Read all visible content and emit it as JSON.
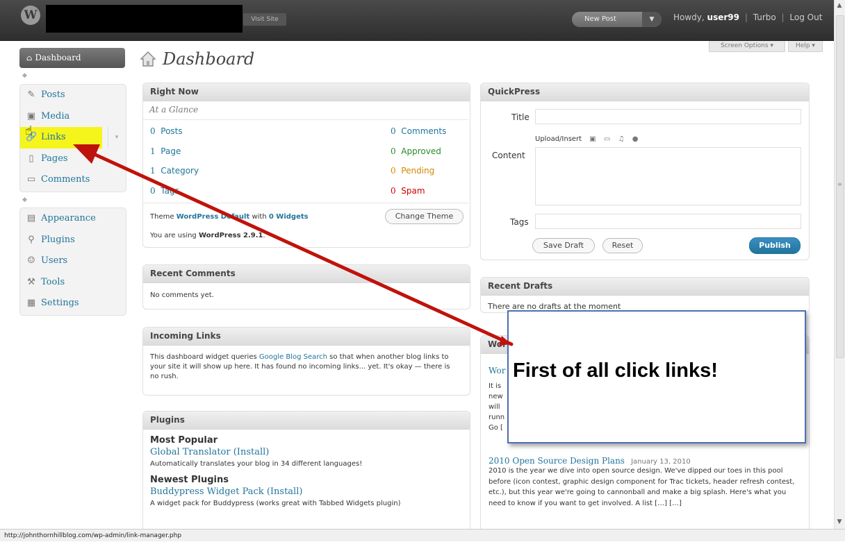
{
  "topbar": {
    "visit_site": "Visit Site",
    "new_post": "New Post",
    "howdy_prefix": "Howdy,",
    "user": "user99",
    "turbo": "Turbo",
    "logout": "Log Out",
    "screen_options": "Screen Options",
    "help": "Help"
  },
  "sidebar": {
    "dashboard": "Dashboard",
    "group1": [
      {
        "label": "Posts",
        "icon": "pin-icon"
      },
      {
        "label": "Media",
        "icon": "media-icon"
      },
      {
        "label": "Links",
        "icon": "link-icon"
      },
      {
        "label": "Pages",
        "icon": "pages-icon"
      },
      {
        "label": "Comments",
        "icon": "comments-icon"
      }
    ],
    "group2": [
      {
        "label": "Appearance",
        "icon": "appearance-icon"
      },
      {
        "label": "Plugins",
        "icon": "plugins-icon"
      },
      {
        "label": "Users",
        "icon": "users-icon"
      },
      {
        "label": "Tools",
        "icon": "tools-icon"
      },
      {
        "label": "Settings",
        "icon": "settings-icon"
      }
    ]
  },
  "page": {
    "title": "Dashboard"
  },
  "right_now": {
    "title": "Right Now",
    "subtitle": "At a Glance",
    "posts_n": "0",
    "posts": "Posts",
    "page_n": "1",
    "page": "Page",
    "category_n": "1",
    "category": "Category",
    "tags_n": "0",
    "tags": "Tags",
    "comments_n": "0",
    "comments": "Comments",
    "approved_n": "0",
    "approved": "Approved",
    "pending_n": "0",
    "pending": "Pending",
    "spam_n": "0",
    "spam": "Spam",
    "theme_prefix": "Theme",
    "theme_name": "WordPress Default",
    "theme_mid": "with",
    "widgets": "0 Widgets",
    "change_theme": "Change Theme",
    "using_prefix": "You are using",
    "version": "WordPress 2.9.1",
    "using_suffix": "."
  },
  "recent_comments": {
    "title": "Recent Comments",
    "text": "No comments yet."
  },
  "incoming_links": {
    "title": "Incoming Links",
    "text_a": "This dashboard widget queries",
    "link": "Google Blog Search",
    "text_b": "so that when another blog links to your site it will show up here. It has found no incoming links... yet. It's okay — there is no rush."
  },
  "plugins_box": {
    "title": "Plugins",
    "most_popular": "Most Popular",
    "p1_name": "Global Translator",
    "p1_install": "(Install)",
    "p1_desc": "Automatically translates your blog in 34 different languages!",
    "newest": "Newest Plugins",
    "p2_name": "Buddypress Widget Pack",
    "p2_install": "(Install)",
    "p2_desc": "A widget pack for Buddypress (works great with Tabbed Widgets plugin)"
  },
  "quickpress": {
    "title": "QuickPress",
    "title_label": "Title",
    "upload_insert": "Upload/Insert",
    "content_label": "Content",
    "tags_label": "Tags",
    "save_draft": "Save Draft",
    "reset": "Reset",
    "publish": "Publish"
  },
  "recent_drafts": {
    "title": "Recent Drafts",
    "text": "There are no drafts at the moment"
  },
  "news": {
    "title_partial": "Wor",
    "item1_partial": "Wor",
    "line_frags": [
      "It is",
      "new",
      "will",
      "runn",
      "Go ["
    ],
    "item2_title": "2010 Open Source Design Plans",
    "item2_date": "January 13, 2010",
    "item2_text": "2010 is the year we dive into open source design. We've dipped our toes in this pool before (icon contest, graphic design component for Trac tickets, header refresh contest, etc.), but this year we're going to cannonball and make a big splash. Here's what you need to know if you want to get involved. A list […] […]"
  },
  "callout": {
    "text": "First of all click links!"
  },
  "statusbar": {
    "url": "http://johnthornhillblog.com/wp-admin/link-manager.php"
  }
}
